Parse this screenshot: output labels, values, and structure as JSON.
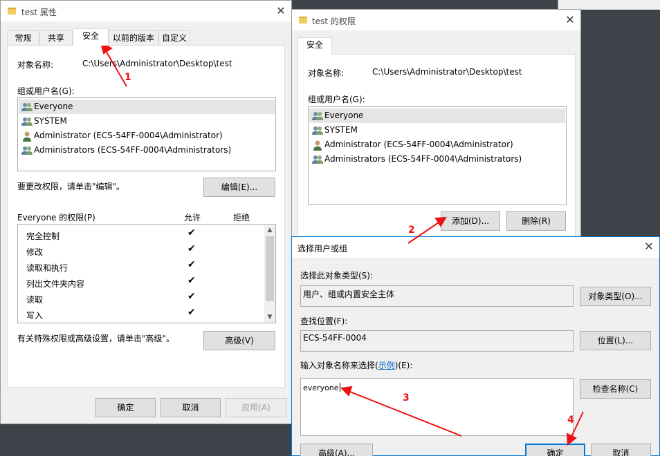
{
  "props": {
    "title": "test 属性",
    "tabs": [
      "常规",
      "共享",
      "安全",
      "以前的版本",
      "自定义"
    ],
    "object_name_label": "对象名称:",
    "object_name_value": "C:\\Users\\Administrator\\Desktop\\test",
    "group_label": "组或用户名(G):",
    "users": [
      "Everyone",
      "SYSTEM",
      "Administrator (ECS-54FF-0004\\Administrator)",
      "Administrators (ECS-54FF-0004\\Administrators)"
    ],
    "edit_hint": "要更改权限，请单击\"编辑\"。",
    "edit_button": "编辑(E)...",
    "perm_label": "Everyone 的权限(P)",
    "allow_label": "允许",
    "deny_label": "拒绝",
    "permissions": [
      "完全控制",
      "修改",
      "读取和执行",
      "列出文件夹内容",
      "读取",
      "写入"
    ],
    "special_hint": "有关特殊权限或高级设置，请单击\"高级\"。",
    "advanced_button": "高级(V)",
    "ok_button": "确定",
    "cancel_button": "取消",
    "apply_button": "应用(A)"
  },
  "perms": {
    "title": "test 的权限",
    "tab": "安全",
    "object_name_label": "对象名称:",
    "object_name_value": "C:\\Users\\Administrator\\Desktop\\test",
    "group_label": "组或用户名(G):",
    "users": [
      "Everyone",
      "SYSTEM",
      "Administrator (ECS-54FF-0004\\Administrator)",
      "Administrators (ECS-54FF-0004\\Administrators)"
    ],
    "add_button": "添加(D)...",
    "remove_button": "删除(R)"
  },
  "select": {
    "title": "选择用户或组",
    "type_label": "选择此对象类型(S):",
    "type_value": "用户、组或内置安全主体",
    "type_button": "对象类型(O)...",
    "location_label": "查找位置(F):",
    "location_value": "ECS-54FF-0004",
    "location_button": "位置(L)...",
    "names_label_pre": "输入对象名称来选择(",
    "names_label_link": "示例",
    "names_label_post": ")(E):",
    "names_value": "everyone",
    "check_button": "检查名称(C)",
    "advanced_button": "高级(A)...",
    "ok_button": "确定",
    "cancel_button": "取消"
  },
  "annotations": [
    "1",
    "2",
    "3",
    "4"
  ],
  "colors": {
    "annotation": "#ee1111",
    "accent": "#0078d7"
  }
}
